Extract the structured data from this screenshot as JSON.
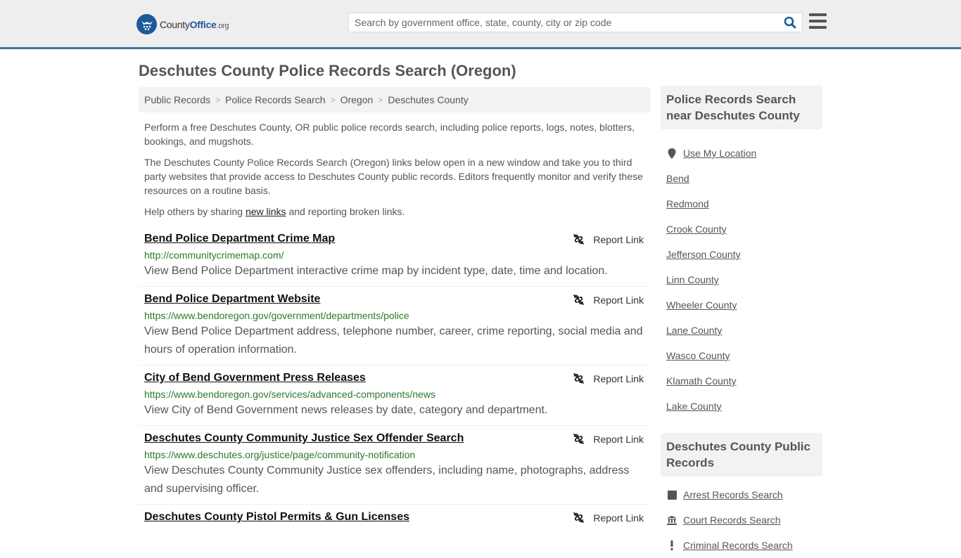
{
  "header": {
    "logo": {
      "part1": "County",
      "part2": "Office",
      "part3": ".org"
    },
    "search_placeholder": "Search by government office, state, county, city or zip code",
    "search_value": "",
    "colors": {
      "brand": "#1a5a9a",
      "topbar_border": "#3b76a6"
    }
  },
  "page": {
    "title": "Deschutes County Police Records Search (Oregon)",
    "breadcrumb": [
      "Public Records",
      "Police Records Search",
      "Oregon",
      "Deschutes County"
    ],
    "intro": {
      "p1": "Perform a free Deschutes County, OR public police records search, including police reports, logs, notes, blotters, bookings, and mugshots.",
      "p2": "The Deschutes County Police Records Search (Oregon) links below open in a new window and take you to third party websites that provide access to Deschutes County public records. Editors frequently monitor and verify these resources on a routine basis.",
      "p3_before": "Help others by sharing ",
      "p3_link": "new links",
      "p3_after": " and reporting broken links."
    },
    "report_label": "Report Link",
    "results": [
      {
        "title": "Bend Police Department Crime Map",
        "url": "http://communitycrimemap.com/",
        "desc": "View Bend Police Department interactive crime map by incident type, date, time and location."
      },
      {
        "title": "Bend Police Department Website",
        "url": "https://www.bendoregon.gov/government/departments/police",
        "desc": "View Bend Police Department address, telephone number, career, crime reporting, social media and hours of operation information."
      },
      {
        "title": "City of Bend Government Press Releases",
        "url": "https://www.bendoregon.gov/services/advanced-components/news",
        "desc": "View City of Bend Government news releases by date, category and department."
      },
      {
        "title": "Deschutes County Community Justice Sex Offender Search",
        "url": "https://www.deschutes.org/justice/page/community-notification",
        "desc": "View Deschutes County Community Justice sex offenders, including name, photographs, address and supervising officer."
      },
      {
        "title": "Deschutes County Pistol Permits & Gun Licenses",
        "url": "",
        "desc": ""
      }
    ]
  },
  "sidebar": {
    "nearby": {
      "heading": "Police Records Search near Deschutes County",
      "use_location": "Use My Location",
      "links": [
        "Bend",
        "Redmond",
        "Crook County",
        "Jefferson County",
        "Linn County",
        "Wheeler County",
        "Lane County",
        "Wasco County",
        "Klamath County",
        "Lake County"
      ]
    },
    "public_records": {
      "heading": "Deschutes County Public Records",
      "links": [
        {
          "label": "Arrest Records Search",
          "icon": "square-icon"
        },
        {
          "label": "Court Records Search",
          "icon": "courthouse-icon"
        },
        {
          "label": "Criminal Records Search",
          "icon": "exclamation-icon"
        }
      ]
    }
  }
}
